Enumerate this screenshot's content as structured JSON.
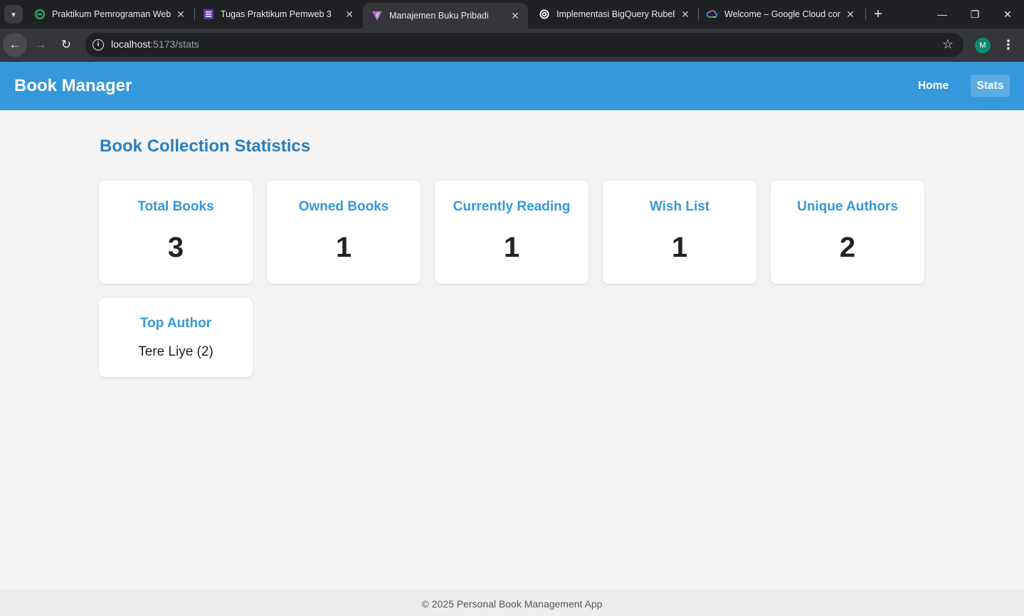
{
  "browser": {
    "tabs": [
      {
        "title": "Praktikum Pemrograman Web"
      },
      {
        "title": "Tugas Praktikum Pemweb 3"
      },
      {
        "title": "Manajemen Buku Pribadi"
      },
      {
        "title": "Implementasi BigQuery Rubella"
      },
      {
        "title": "Welcome – Google Cloud console"
      }
    ],
    "url_host": "localhost",
    "url_rest": ":5173/stats",
    "profile_initial": "M"
  },
  "app": {
    "brand": "Book Manager",
    "nav": {
      "home": "Home",
      "stats": "Stats"
    },
    "page_title": "Book Collection Statistics",
    "stats": [
      {
        "label": "Total Books",
        "value": "3"
      },
      {
        "label": "Owned Books",
        "value": "1"
      },
      {
        "label": "Currently Reading",
        "value": "1"
      },
      {
        "label": "Wish List",
        "value": "1"
      },
      {
        "label": "Unique Authors",
        "value": "2"
      }
    ],
    "top_author": {
      "label": "Top Author",
      "value": "Tere Liye (2)"
    },
    "footer": "© 2025 Personal Book Management App"
  },
  "colors": {
    "accent": "#3498db",
    "title": "#2a7fbf"
  }
}
